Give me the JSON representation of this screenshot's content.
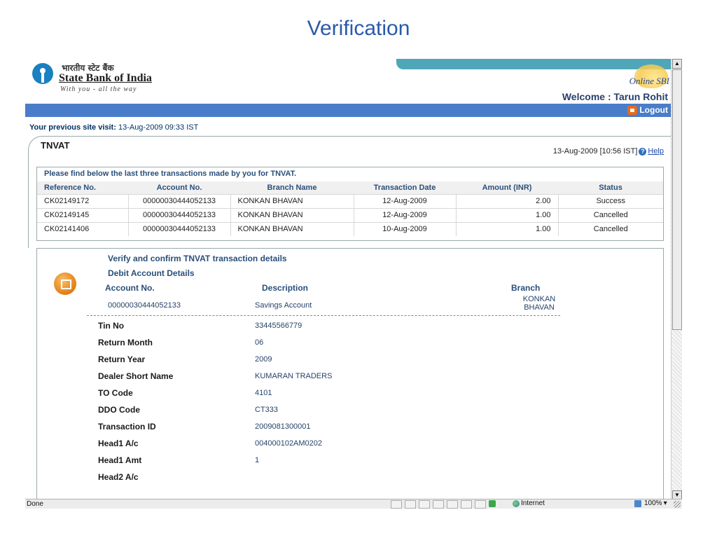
{
  "slide": {
    "title": "Verification"
  },
  "header": {
    "logo_hindi": "भारतीय स्टेट बैंक",
    "logo_english": "State Bank of India",
    "logo_tagline": "With you - all the way",
    "online_logo": "Online SBI",
    "welcome": "Welcome : Tarun Rohit",
    "logout": "Logout"
  },
  "previous_visit": {
    "label": "Your previous site visit:",
    "value": "13-Aug-2009 09:33 IST"
  },
  "panel": {
    "title": "TNVAT",
    "datetime": "13-Aug-2009 [10:56 IST]",
    "help": "Help"
  },
  "transactions": {
    "caption": "Please find below the last three transactions made by you for TNVAT.",
    "headers": [
      "Reference No.",
      "Account No.",
      "Branch Name",
      "Transaction Date",
      "Amount (INR)",
      "Status"
    ],
    "rows": [
      [
        "CK02149172",
        "00000030444052133",
        "KONKAN BHAVAN",
        "12-Aug-2009",
        "2.00",
        "Success"
      ],
      [
        "CK02149145",
        "00000030444052133",
        "KONKAN BHAVAN",
        "12-Aug-2009",
        "1.00",
        "Cancelled"
      ],
      [
        "CK02141406",
        "00000030444052133",
        "KONKAN BHAVAN",
        "10-Aug-2009",
        "1.00",
        "Cancelled"
      ]
    ]
  },
  "verify": {
    "heading": "Verify and confirm TNVAT transaction details",
    "debit_heading": "Debit Account Details",
    "col_account": "Account No.",
    "col_description": "Description",
    "col_branch": "Branch",
    "account_no": "00000030444052133",
    "description": "Savings Account",
    "branch_line1": "KONKAN",
    "branch_line2": "BHAVAN",
    "fields": [
      {
        "label": "Tin No",
        "value": "33445566779"
      },
      {
        "label": "Return Month",
        "value": "06"
      },
      {
        "label": "Return Year",
        "value": "2009"
      },
      {
        "label": "Dealer Short Name",
        "value": "KUMARAN TRADERS"
      },
      {
        "label": "TO Code",
        "value": "4101"
      },
      {
        "label": "DDO Code",
        "value": "CT333"
      },
      {
        "label": "Transaction ID",
        "value": "2009081300001"
      },
      {
        "label": "Head1 A/c",
        "value": "004000102AM0202"
      },
      {
        "label": "Head1 Amt",
        "value": "1"
      },
      {
        "label": "Head2 A/c",
        "value": ""
      }
    ]
  },
  "statusbar": {
    "status": "Done",
    "zone": "Internet",
    "zoom": "100%"
  },
  "icons": [
    "sbi-keyhole-icon",
    "logout-icon",
    "help-icon",
    "verify-document-icon",
    "globe-icon",
    "zoom-icon",
    "zone-icon"
  ],
  "colors": {
    "blue_bar": "#4a7dc9",
    "stripe": "#4fa6b8",
    "title_blue": "#2a5aa8",
    "verify_orange": "#e27d12"
  }
}
